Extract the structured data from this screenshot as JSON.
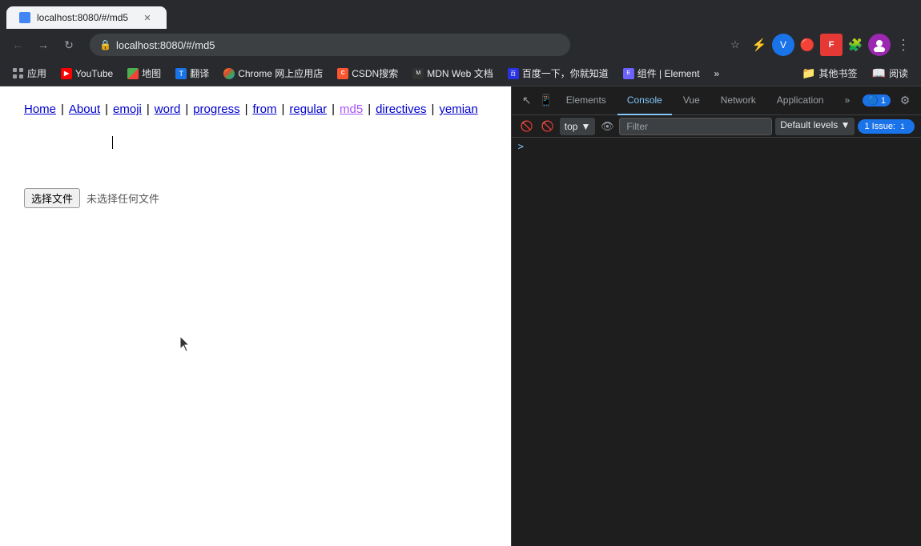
{
  "browser": {
    "url": "localhost:8080/#/md5",
    "tab_title": "localhost:8080/#/md5"
  },
  "bookmarks": {
    "items": [
      {
        "id": "apps",
        "label": "应用",
        "icon": "grid"
      },
      {
        "id": "youtube",
        "label": "YouTube",
        "icon": "yt"
      },
      {
        "id": "maps",
        "label": "地图",
        "icon": "maps"
      },
      {
        "id": "translate",
        "label": "翻译",
        "icon": "translate"
      },
      {
        "id": "chrome-store",
        "label": "Chrome 网上应用店",
        "icon": "chrome"
      },
      {
        "id": "csdn",
        "label": "CSDN搜索",
        "icon": "csdn"
      },
      {
        "id": "mdn",
        "label": "MDN Web 文档",
        "icon": "mdn"
      },
      {
        "id": "baidu",
        "label": "百度一下，你就知道",
        "icon": "baidu"
      },
      {
        "id": "element",
        "label": "组件 | Element",
        "icon": "element"
      },
      {
        "id": "more",
        "label": "»",
        "icon": "more"
      },
      {
        "id": "bookmarks-folder",
        "label": "其他书签",
        "icon": "folder"
      },
      {
        "id": "reader",
        "label": "阅读",
        "icon": "reader"
      }
    ]
  },
  "page": {
    "nav": {
      "links": [
        {
          "id": "home",
          "label": "Home",
          "active": false,
          "color": "#00c"
        },
        {
          "id": "about",
          "label": "About",
          "active": false,
          "color": "#00c"
        },
        {
          "id": "emoji",
          "label": "emoji",
          "active": false,
          "color": "#00c"
        },
        {
          "id": "word",
          "label": "word",
          "active": false,
          "color": "#00c"
        },
        {
          "id": "progress",
          "label": "progress",
          "active": false,
          "color": "#00c"
        },
        {
          "id": "from",
          "label": "from",
          "active": false,
          "color": "#00c"
        },
        {
          "id": "regular",
          "label": "regular",
          "active": false,
          "color": "#00c"
        },
        {
          "id": "md5",
          "label": "md5",
          "active": true,
          "color": "#a855f7"
        },
        {
          "id": "directives",
          "label": "directives",
          "active": false,
          "color": "#00c"
        },
        {
          "id": "yemian",
          "label": "yemian",
          "active": false,
          "color": "#00c"
        }
      ]
    },
    "file_input": {
      "button_label": "选择文件",
      "no_file_text": "未选择任何文件"
    }
  },
  "devtools": {
    "tabs": [
      "Elements",
      "Console",
      "Vue",
      "Network",
      "Application"
    ],
    "active_tab": "Console",
    "more_label": "»",
    "issue_count": "1",
    "issue_label": "1 Issue:",
    "filter_placeholder": "Filter",
    "context": "top",
    "levels": "Default levels",
    "console_arrow": ">"
  }
}
